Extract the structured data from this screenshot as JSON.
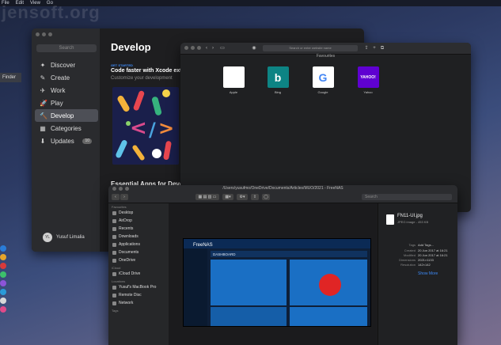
{
  "menubar": {
    "items": [
      "File",
      "Edit",
      "View",
      "Go"
    ]
  },
  "watermark": "jensoft.org",
  "desktop": {
    "finder_label": "Finder"
  },
  "appstore": {
    "search_placeholder": "Search",
    "nav": [
      {
        "icon": "discover-icon",
        "glyph": "✦",
        "label": "Discover"
      },
      {
        "icon": "create-icon",
        "glyph": "✎",
        "label": "Create"
      },
      {
        "icon": "work-icon",
        "glyph": "✈",
        "label": "Work"
      },
      {
        "icon": "play-icon",
        "glyph": "🚀",
        "label": "Play"
      },
      {
        "icon": "develop-icon",
        "glyph": "🔨",
        "label": "Develop"
      },
      {
        "icon": "categories-icon",
        "glyph": "▦",
        "label": "Categories"
      },
      {
        "icon": "updates-icon",
        "glyph": "⬇",
        "label": "Updates",
        "badge": "10"
      }
    ],
    "active_index": 4,
    "user": {
      "initials": "YL",
      "name": "Yusuf Limalia"
    },
    "title": "Develop",
    "feature": {
      "eyebrow": "GET STARTED",
      "title": "Code faster with Xcode exten",
      "subtitle": "Customize your development"
    },
    "section_title": "Essential Apps for Develo"
  },
  "safari": {
    "url_placeholder": "Search or enter website name",
    "favorites_heading": "Favourites",
    "favorites": [
      {
        "label": "Apple",
        "icon": "apple-icon",
        "glyph": "",
        "bg": "#ffffff",
        "fg": "#111111"
      },
      {
        "label": "Bing",
        "icon": "bing-icon",
        "glyph": "b",
        "bg": "#0d8484",
        "fg": "#ffffff"
      },
      {
        "label": "Google",
        "icon": "google-icon",
        "glyph": "G",
        "bg": "#ffffff",
        "fg": "#4285f4"
      },
      {
        "label": "Yahoo",
        "icon": "yahoo-icon",
        "glyph": "YAHOO!",
        "bg": "#5f01d1",
        "fg": "#ffffff"
      }
    ]
  },
  "finder": {
    "title": "/Users/yusufmo/OneDrive/Documents/Articles/MUO/2021 - FreeNAS",
    "search_placeholder": "Search",
    "sidebar": {
      "favourites_heading": "Favourites",
      "favourites": [
        "Desktop",
        "AirDrop",
        "Recents",
        "Downloads",
        "Applications",
        "Documents",
        "OneDrive"
      ],
      "icloud_heading": "iCloud",
      "icloud": [
        "iCloud Drive"
      ],
      "locations_heading": "Locations",
      "locations": [
        "Yusuf's MacBook Pro",
        "Remote Disc",
        "Network"
      ],
      "tags_heading": "Tags"
    },
    "preview": {
      "brand": "FreeNAS",
      "dashboard": "DASHBOARD"
    },
    "info": {
      "file_name": "FN11-UI.jpg",
      "file_kind": "JPEG image - 453 KB",
      "rows": [
        {
          "k": "Tags",
          "v": "Add Tags..."
        },
        {
          "k": "Created",
          "v": "20 Jun 2017 at 16:21"
        },
        {
          "k": "Modified",
          "v": "20 Jun 2017 at 16:21"
        },
        {
          "k": "Dimensions",
          "v": "2021×1133"
        },
        {
          "k": "Resolution",
          "v": "142×142"
        }
      ],
      "show_more": "Show More"
    }
  }
}
